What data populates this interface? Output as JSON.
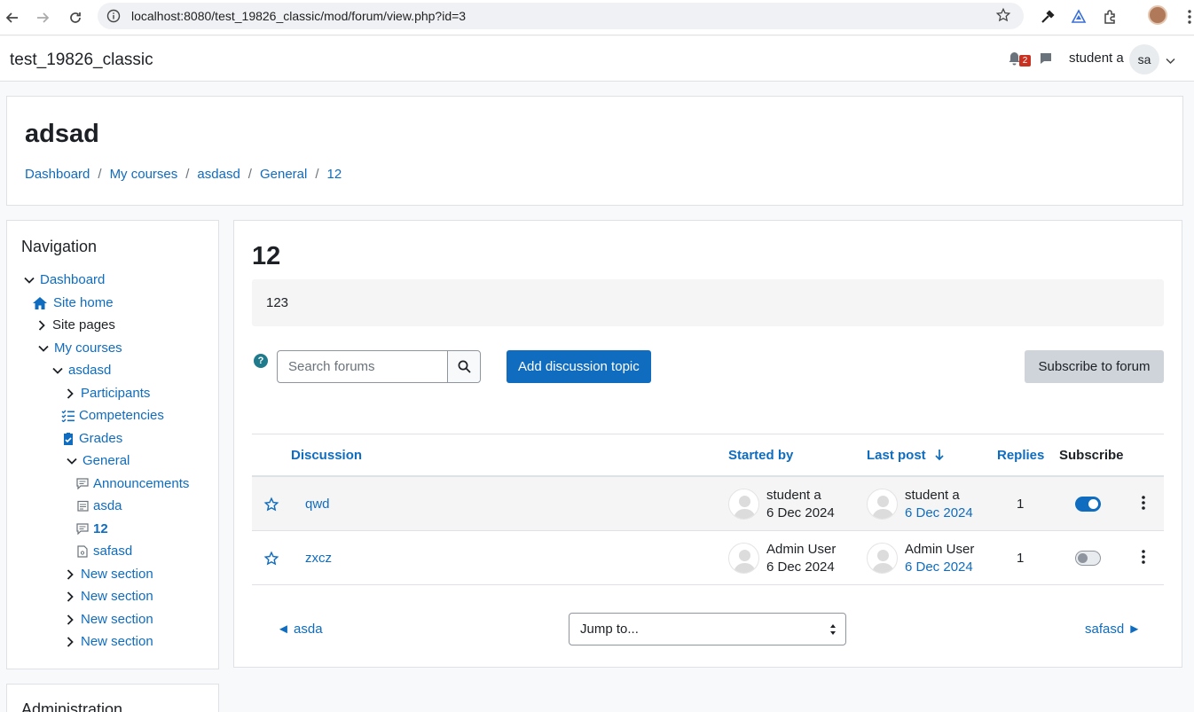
{
  "browser": {
    "url": "localhost:8080/test_19826_classic/mod/forum/view.php?id=3"
  },
  "header": {
    "site_name": "test_19826_classic",
    "notification_count": "2",
    "user_name": "student a",
    "avatar_initials": "sa"
  },
  "page": {
    "heading": "adsad",
    "breadcrumb": [
      "Dashboard",
      "My courses",
      "asdasd",
      "General",
      "12"
    ]
  },
  "navigation": {
    "title": "Navigation",
    "items": [
      {
        "label": "Dashboard",
        "icon": "chevron-down-icon"
      },
      {
        "label": "Site home",
        "icon": "home-icon"
      },
      {
        "label": "Site pages",
        "icon": "chevron-right-icon"
      },
      {
        "label": "My courses",
        "icon": "chevron-down-icon"
      },
      {
        "label": "asdasd",
        "icon": "chevron-down-icon"
      },
      {
        "label": "Participants",
        "icon": "chevron-right-icon"
      },
      {
        "label": "Competencies",
        "icon": "list-check-icon"
      },
      {
        "label": "Grades",
        "icon": "clipboard-check-icon"
      },
      {
        "label": "General",
        "icon": "chevron-down-icon"
      },
      {
        "label": "Announcements",
        "icon": "forum-icon"
      },
      {
        "label": "asda",
        "icon": "calendar-icon"
      },
      {
        "label": "12",
        "icon": "forum-icon"
      },
      {
        "label": "safasd",
        "icon": "file-icon"
      },
      {
        "label": "New section",
        "icon": "chevron-right-icon"
      },
      {
        "label": "New section",
        "icon": "chevron-right-icon"
      },
      {
        "label": "New section",
        "icon": "chevron-right-icon"
      },
      {
        "label": "New section",
        "icon": "chevron-right-icon"
      }
    ]
  },
  "administration": {
    "title": "Administration"
  },
  "forum": {
    "title": "12",
    "intro": "123",
    "search_placeholder": "Search forums",
    "add_topic_label": "Add discussion topic",
    "subscribe_label": "Subscribe to forum",
    "columns": {
      "discussion": "Discussion",
      "started_by": "Started by",
      "last_post": "Last post",
      "replies": "Replies",
      "subscribe": "Subscribe"
    },
    "rows": [
      {
        "topic": "qwd",
        "started_by": "student a",
        "started_date": "6 Dec 2024",
        "last_by": "student a",
        "last_date": "6 Dec 2024",
        "replies": "1",
        "subscribed": true
      },
      {
        "topic": "zxcz",
        "started_by": "Admin User",
        "started_date": "6 Dec 2024",
        "last_by": "Admin User",
        "last_date": "6 Dec 2024",
        "replies": "1",
        "subscribed": false
      }
    ],
    "prev_activity": "◄ asda",
    "jump_to": "Jump to...",
    "next_activity": "safasd ►"
  },
  "colors": {
    "link": "#0f6cbf",
    "primary_button": "#0f6cbf",
    "secondary_button": "#ced4da",
    "badge": "#ca3120"
  }
}
